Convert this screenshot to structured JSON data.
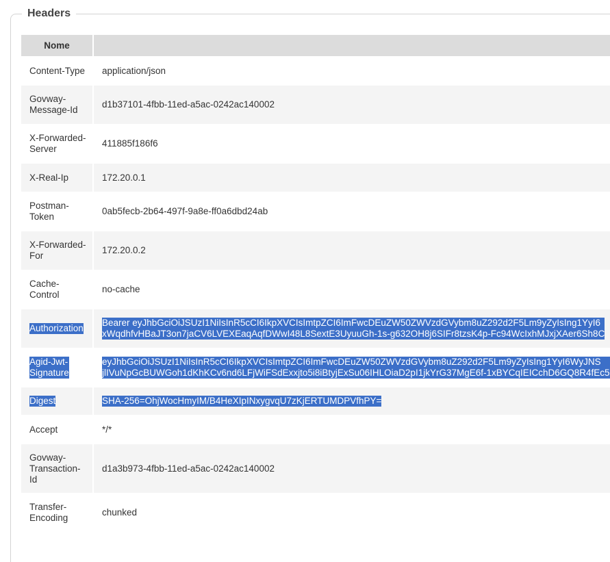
{
  "section": {
    "legend": "Headers"
  },
  "table": {
    "header": {
      "name": "Nome",
      "value": ""
    },
    "rows": [
      {
        "name": [
          "Content-Type"
        ],
        "value": [
          "application/json"
        ],
        "selected": false
      },
      {
        "name": [
          "Govway-",
          "Message-Id"
        ],
        "value": [
          "d1b37101-4fbb-11ed-a5ac-0242ac140002"
        ],
        "selected": false
      },
      {
        "name": [
          "X-Forwarded-",
          "Server"
        ],
        "value": [
          "411885f186f6"
        ],
        "selected": false
      },
      {
        "name": [
          "X-Real-Ip"
        ],
        "value": [
          "172.20.0.1"
        ],
        "selected": false
      },
      {
        "name": [
          "Postman-",
          "Token"
        ],
        "value": [
          "0ab5fecb-2b64-497f-9a8e-ff0a6dbd24ab"
        ],
        "selected": false
      },
      {
        "name": [
          "X-Forwarded-",
          "For"
        ],
        "value": [
          "172.20.0.2"
        ],
        "selected": false
      },
      {
        "name": [
          "Cache-",
          "Control"
        ],
        "value": [
          "no-cache"
        ],
        "selected": false
      },
      {
        "name": [
          "Authorization"
        ],
        "value": [
          "Bearer eyJhbGciOiJSUzI1NiIsInR5cCI6IkpXVCIsImtpZCI6ImFwcDEuZW50ZWVzdGVybm8uZ292d2F5Lm9yZyIsIng1YyI6",
          "xWqdhfvHBaJT3on7jaCV6LVEXEaqAqfDWwI48L8SextE3UyuuGh-1s-g632OH8j6SIFr8tzsK4p-Fc94WcIxhMJxjXAer6Sh8C"
        ],
        "selected": true
      },
      {
        "name": [
          "Agid-Jwt-",
          "Signature"
        ],
        "value": [
          "eyJhbGciOiJSUzI1NiIsInR5cCI6IkpXVCIsImtpZCI6ImFwcDEuZW50ZWVzdGVybm8uZ292d2F5Lm9yZyIsIng1YyI6WyJNS",
          "jlIVuNpGcBUWGoh1dKhKCv6nd6LFjWiFSdExxjto5i8iBtyjExSu06IHLOiaD2pI1jkYrG37MgE6f-1xBYCqIEICchD6GQ8R4fEc5"
        ],
        "selected": true
      },
      {
        "name": [
          "Digest"
        ],
        "value": [
          "SHA-256=OhjWocHmyIM/B4HeXIpINxygvqU7zKjERTUMDPVfhPY="
        ],
        "selected": true
      },
      {
        "name": [
          "Accept"
        ],
        "value": [
          "*/*"
        ],
        "selected": false
      },
      {
        "name": [
          "Govway-",
          "Transaction-",
          "Id"
        ],
        "value": [
          "d1a3b973-4fbb-11ed-a5ac-0242ac140002"
        ],
        "selected": false
      },
      {
        "name": [
          "Transfer-",
          "Encoding"
        ],
        "value": [
          "chunked"
        ],
        "selected": false
      }
    ]
  }
}
